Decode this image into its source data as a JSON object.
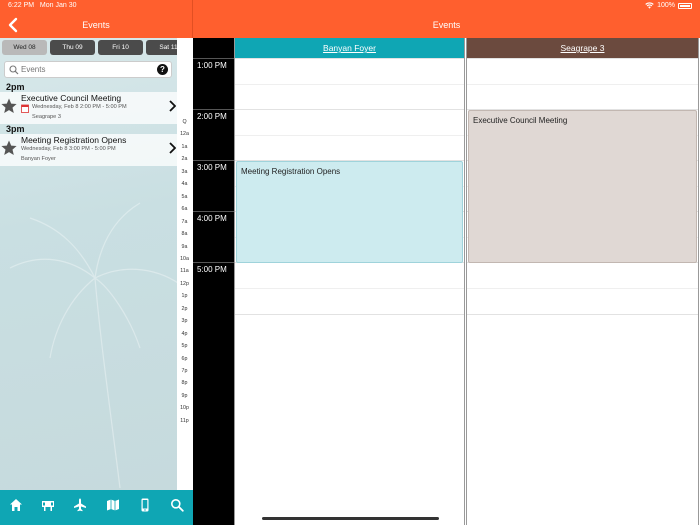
{
  "status_bar": {
    "time": "6:22 PM",
    "date": "Mon Jan 30",
    "battery": "100%"
  },
  "left_header": {
    "title": "Events"
  },
  "right_header": {
    "title": "Events"
  },
  "day_tabs": [
    {
      "label": "Wed 08",
      "active": true
    },
    {
      "label": "Thu 09",
      "active": false
    },
    {
      "label": "Fri 10",
      "active": false
    },
    {
      "label": "Sat 11",
      "active": false
    }
  ],
  "search": {
    "placeholder": "Events",
    "help": "?"
  },
  "event_list": [
    {
      "heading": "2pm",
      "title": "Executive Council Meeting",
      "date": "Wednesday, Feb 8 2:00 PM - 5:00 PM",
      "location": "Seagrape 3"
    },
    {
      "heading": "3pm",
      "title": "Meeting Registration Opens",
      "date": "Wednesday, Feb 8 3:00 PM - 5:00 PM",
      "location": "Banyan Foyer"
    }
  ],
  "alpha_index": [
    "Q",
    "12a",
    "1a",
    "2a",
    "3a",
    "4a",
    "5a",
    "6a",
    "7a",
    "8a",
    "9a",
    "10a",
    "11a",
    "12p",
    "1p",
    "2p",
    "3p",
    "4p",
    "5p",
    "6p",
    "7p",
    "8p",
    "9p",
    "10p",
    "11p"
  ],
  "schedule": {
    "time_labels": [
      "1:00 PM",
      "2:00 PM",
      "3:00 PM",
      "4:00 PM",
      "5:00 PM"
    ],
    "rooms": [
      {
        "name": "Banyan Foyer",
        "color": "#0fa6b4"
      },
      {
        "name": "Seagrape 3",
        "color": "#6b4a3e"
      }
    ],
    "events": [
      {
        "title": "Meeting Registration Opens",
        "color": "#cdebef",
        "border": "#9fd3db"
      },
      {
        "title": "Executive Council Meeting",
        "color": "#e0d8d4",
        "border": "#c2b7b1"
      }
    ]
  },
  "colors": {
    "accent": "#ff5f2e",
    "teal": "#0fa6b4",
    "brown": "#6b4a3e"
  }
}
